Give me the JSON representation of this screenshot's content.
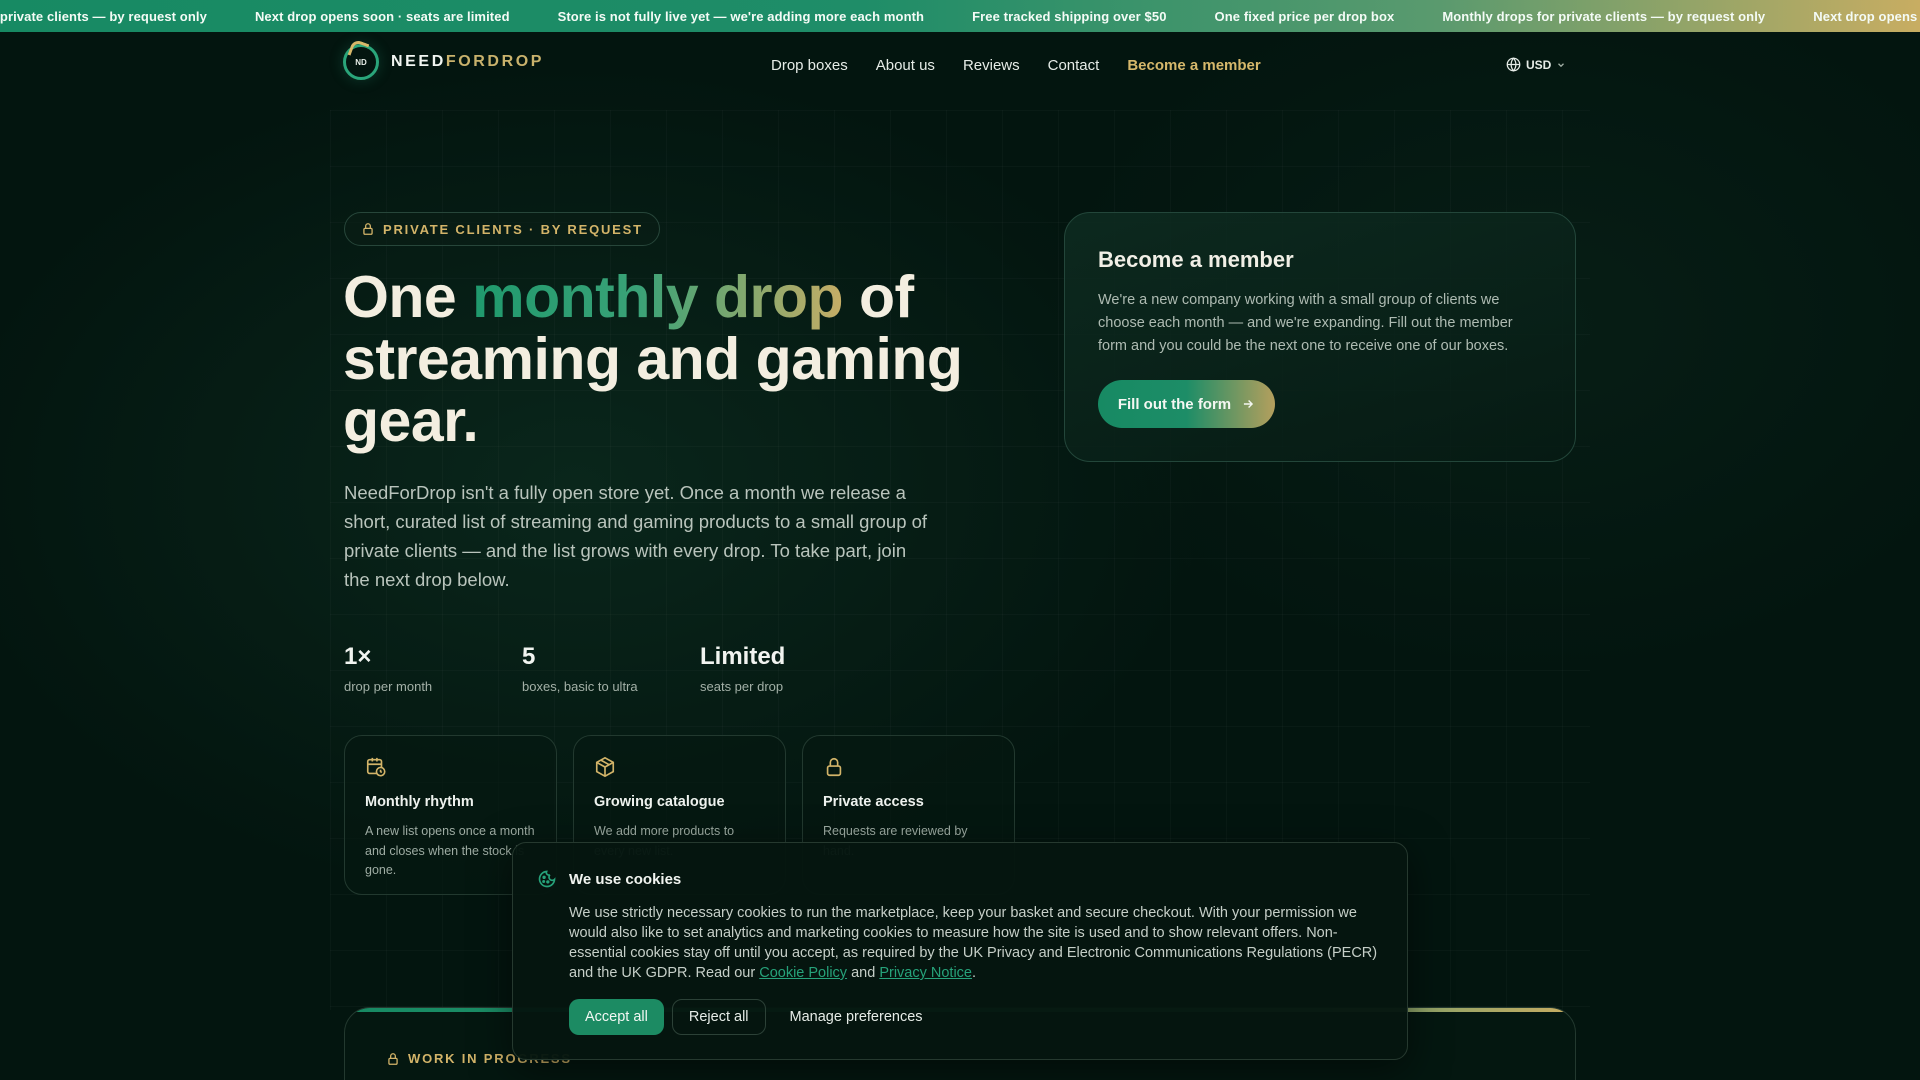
{
  "ticker": {
    "items": [
      "Monthly drops for private clients — by request only",
      "Next drop opens soon · seats are limited",
      "Store is not fully live yet — we're adding more each month",
      "Free tracked shipping over $50",
      "One fixed price per drop box",
      "Monthly drops for private clients — by request only",
      "Next drop opens soon · seats are limited"
    ]
  },
  "header": {
    "logo_mark": "ND",
    "logo_word_1": "NEED",
    "logo_word_2": "FORDROP",
    "nav": [
      "Drop boxes",
      "About us",
      "Reviews",
      "Contact",
      "Become a member"
    ],
    "currency": "USD"
  },
  "hero": {
    "badge": "PRIVATE CLIENTS · BY REQUEST",
    "title_pre": "One ",
    "title_highlight": "monthly drop",
    "title_post": " of streaming and gaming gear.",
    "description": "NeedForDrop isn't a fully open store yet. Once a month we release a short, curated list of streaming and gaming products to a small group of private clients — and the list grows with every drop. To take part, join the next drop below."
  },
  "stats": [
    {
      "value": "1×",
      "label": "drop per month"
    },
    {
      "value": "5",
      "label": "boxes, basic to ultra"
    },
    {
      "value": "Limited",
      "label": "seats per drop"
    }
  ],
  "features": [
    {
      "icon": "calendar-clock-icon",
      "title": "Monthly rhythm",
      "desc": "A new list opens once a month and closes when the stock is gone."
    },
    {
      "icon": "box-icon",
      "title": "Growing catalogue",
      "desc": "We add more products to every new list."
    },
    {
      "icon": "lock-icon",
      "title": "Private access",
      "desc": "Requests are reviewed by hand."
    }
  ],
  "member": {
    "title": "Become a member",
    "desc": "We're a new company working with a small group of clients we choose each month — and we're expanding. Fill out the member form and you could be the next one to receive one of our boxes.",
    "button": "Fill out the form"
  },
  "wip": {
    "label": "WORK IN PROGRESS"
  },
  "cookie": {
    "title": "We use cookies",
    "body_pre": "We use strictly necessary cookies to run the marketplace, keep your basket and secure checkout. With your permission we would also like to set analytics and marketing cookies to measure how the site is used and to show relevant offers. Non-essential cookies stay off until you accept, as required by the UK Privacy and Electronic Communications Regulations (PECR) and the UK GDPR. Read our ",
    "link_cookie": "Cookie Policy",
    "body_and": " and ",
    "link_privacy": "Privacy Notice",
    "body_end": ".",
    "accept": "Accept all",
    "reject": "Reject all",
    "manage": "Manage preferences"
  },
  "colors": {
    "background": "#03150f",
    "brand_green": "#1c8b63",
    "brand_gold": "#d3b469"
  }
}
